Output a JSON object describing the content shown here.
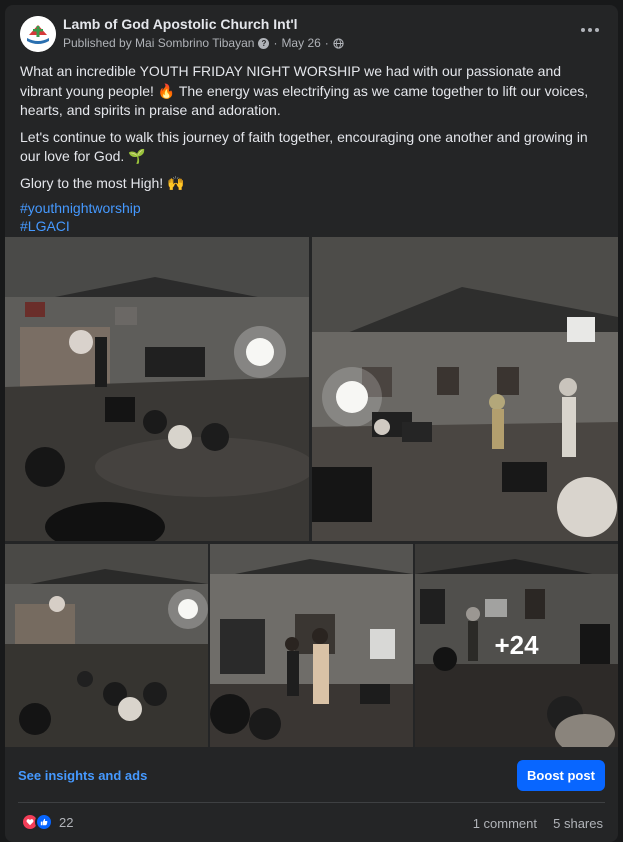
{
  "post": {
    "page_name": "Lamb of God Apostolic Church Int'l",
    "published_by": "Published by Mai Sombrino Tibayan",
    "date": "May 26",
    "separator": "·",
    "paragraph1": "What an incredible YOUTH FRIDAY NIGHT WORSHIP we had with our passionate and vibrant young people! 🔥 The energy was electrifying as we came together to lift our voices, hearts, and spirits in praise and adoration.",
    "paragraph2": "Let's continue to walk this journey of faith together, encouraging one another and growing in our love for God. 🌱",
    "paragraph3": "Glory to the most High! 🙌",
    "hashtags": [
      "#youthnightworship",
      "#LGACI"
    ],
    "more_photos": "+24"
  },
  "actions": {
    "insights": "See insights and ads",
    "boost": "Boost post"
  },
  "stats": {
    "reaction_count": "22",
    "comments": "1 comment",
    "shares": "5 shares"
  },
  "icons": [
    "page-logo-icon",
    "question-icon",
    "globe-icon",
    "more-options-icon",
    "love-reaction-icon",
    "like-reaction-icon"
  ],
  "colors": {
    "background": "#18191a",
    "card": "#242526",
    "text": "#e4e6eb",
    "secondary_text": "#b0b3b8",
    "link": "#4599ff",
    "boost_button": "#0866ff",
    "love": "#f33e58"
  }
}
